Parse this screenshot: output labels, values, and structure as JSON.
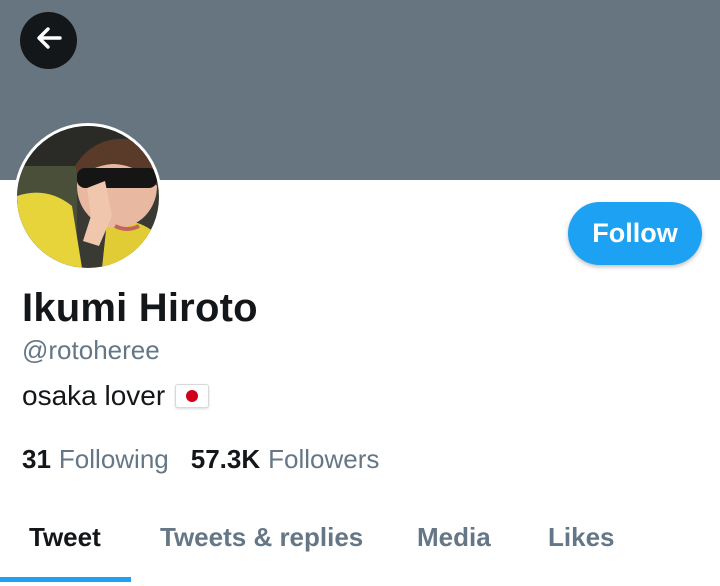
{
  "profile": {
    "display_name": "Ikumi Hiroto",
    "handle": "@rotoheree",
    "bio_text": "osaka lover",
    "bio_emoji": "japan-flag-emoji"
  },
  "actions": {
    "follow_label": "Follow",
    "back_icon": "arrow-left-icon"
  },
  "stats": {
    "following_count": "31",
    "following_label": "Following",
    "followers_count": "57.3K",
    "followers_label": "Followers"
  },
  "tabs": [
    {
      "label": "Tweet",
      "active": true
    },
    {
      "label": "Tweets & replies",
      "active": false
    },
    {
      "label": "Media",
      "active": false
    },
    {
      "label": "Likes",
      "active": false
    }
  ],
  "colors": {
    "banner": "#66757f",
    "accent": "#1da1f2",
    "text_primary": "#14171a",
    "text_secondary": "#657786"
  }
}
